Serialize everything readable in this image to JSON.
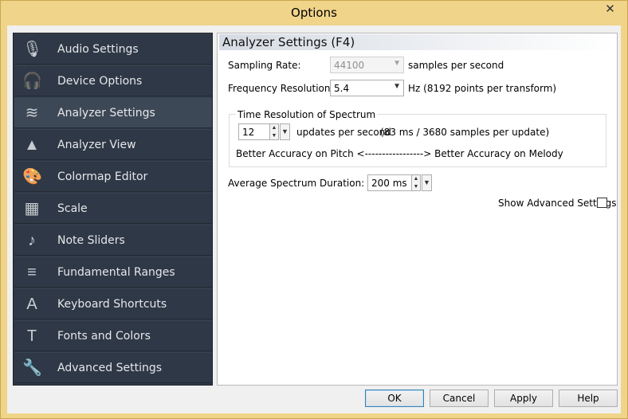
{
  "window": {
    "title": "Options",
    "close_glyph": "✕"
  },
  "sidebar": {
    "items": [
      {
        "label": "Audio Settings",
        "icon": "microphone-icon",
        "glyph": "🎙"
      },
      {
        "label": "Device Options",
        "icon": "headphones-icon",
        "glyph": "🎧"
      },
      {
        "label": "Analyzer Settings",
        "icon": "analyzer-waves-icon",
        "glyph": "≋",
        "active": true
      },
      {
        "label": "Analyzer View",
        "icon": "spectrum-view-icon",
        "glyph": "▲"
      },
      {
        "label": "Colormap Editor",
        "icon": "palette-icon",
        "glyph": "🎨"
      },
      {
        "label": "Scale",
        "icon": "ruler-icon",
        "glyph": "▦"
      },
      {
        "label": "Note Sliders",
        "icon": "music-note-icon",
        "glyph": "♪"
      },
      {
        "label": "Fundamental Ranges",
        "icon": "ranges-icon",
        "glyph": "≡"
      },
      {
        "label": "Keyboard Shortcuts",
        "icon": "keyboard-key-icon",
        "glyph": "A"
      },
      {
        "label": "Fonts and Colors",
        "icon": "font-icon",
        "glyph": "T"
      },
      {
        "label": "Advanced Settings",
        "icon": "wrench-icon",
        "glyph": "🔧"
      }
    ]
  },
  "panel": {
    "title": "Analyzer Settings (F4)",
    "sampling_rate": {
      "label": "Sampling Rate:",
      "value": "44100",
      "unit": "samples per second"
    },
    "frequency_resolution": {
      "label": "Frequency Resolution:",
      "value": "5.4",
      "unit": "Hz (8192 points per transform)"
    },
    "time_resolution": {
      "group_title": "Time Resolution of Spectrum",
      "value": "12",
      "unit": "updates per second",
      "detail": "(83 ms / 3680 samples per update)",
      "hint": "Better Accuracy on Pitch <-----------------> Better Accuracy on Melody"
    },
    "average_duration": {
      "label": "Average Spectrum Duration:",
      "value": "200 ms"
    },
    "show_advanced": {
      "label": "Show Advanced Settings",
      "checked": false
    }
  },
  "buttons": {
    "ok": "OK",
    "cancel": "Cancel",
    "apply": "Apply",
    "help": "Help"
  },
  "arrows": {
    "down": "▼",
    "up": "▲"
  }
}
